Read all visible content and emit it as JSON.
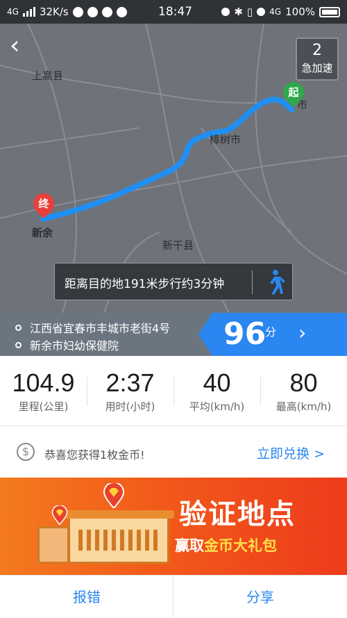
{
  "status_bar": {
    "network": "4G",
    "speed": "32K/s",
    "time": "18:47",
    "network_right": "4G",
    "battery": "100%"
  },
  "map": {
    "labels": {
      "top_left_county": "上高县",
      "city_mid": "樟树市",
      "city_right": "市",
      "city_left": "新余",
      "county_bottom": "新干县"
    },
    "start_pin": "起",
    "end_pin": "终",
    "acceleration": {
      "count": "2",
      "label": "急加速"
    },
    "walk_hint": "距离目的地191米步行约3分钟",
    "route_color": "#1f8ff4"
  },
  "trip": {
    "from": "江西省宜春市丰城市老街4号",
    "to": "新余市妇幼保健院",
    "score": "96",
    "score_unit": "分"
  },
  "stats": [
    {
      "value": "104.9",
      "label": "里程(公里)"
    },
    {
      "value": "2:37",
      "label": "用时(小时)"
    },
    {
      "value": "40",
      "label": "平均(km/h)"
    },
    {
      "value": "80",
      "label": "最高(km/h)"
    }
  ],
  "coin": {
    "message": "恭喜您获得1枚金币!",
    "button": "立即兑换 >"
  },
  "banner": {
    "title": "验证地点",
    "sub_prefix": "赢取",
    "sub_highlight": "金币大礼包"
  },
  "bottom": {
    "report": "报错",
    "share": "分享"
  },
  "colors": {
    "accent": "#2a86f0",
    "banner": "#f25a1a"
  }
}
